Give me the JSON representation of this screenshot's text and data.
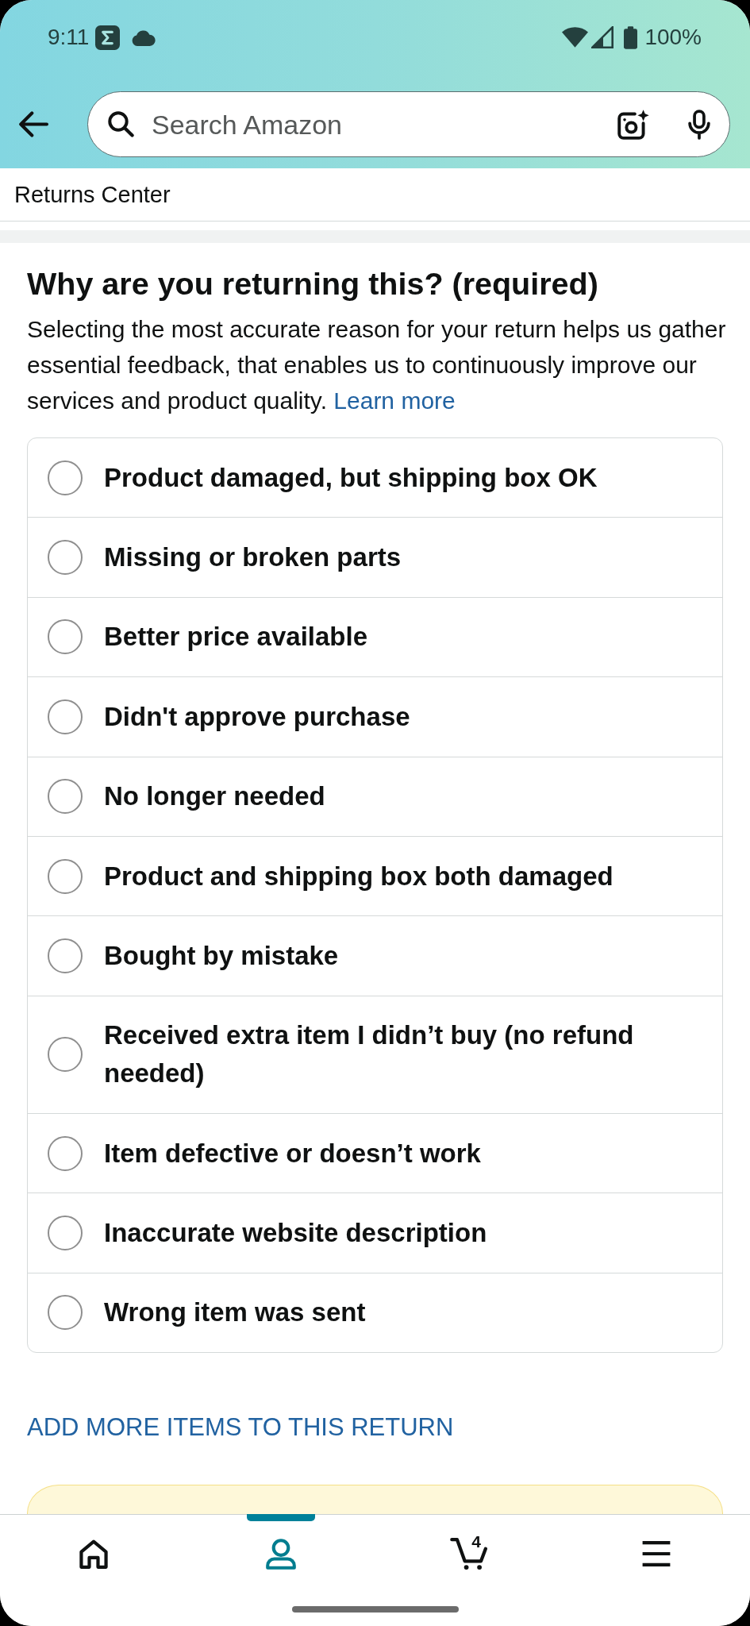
{
  "status_bar": {
    "time": "9:11",
    "battery": "100%"
  },
  "search": {
    "placeholder": "Search Amazon"
  },
  "breadcrumb": "Returns Center",
  "return_reason": {
    "title": "Why are you returning this? (required)",
    "description": "Selecting the most accurate reason for your return helps us gather essential feedback, that enables us to continuously improve our services and product quality.",
    "link": "Learn more",
    "options": [
      {
        "label": "Product damaged, but shipping box OK",
        "selected": false
      },
      {
        "label": "Missing or broken parts",
        "selected": false
      },
      {
        "label": "Better price available",
        "selected": false
      },
      {
        "label": "Didn't approve purchase",
        "selected": false
      },
      {
        "label": "No longer needed",
        "selected": false
      },
      {
        "label": "Product and shipping box both damaged",
        "selected": false
      },
      {
        "label": "Bought by mistake",
        "selected": false
      },
      {
        "label": "Received extra item I didn’t buy (no refund needed)",
        "selected": false
      },
      {
        "label": "Item defective or doesn’t work",
        "selected": false
      },
      {
        "label": "Inaccurate website description",
        "selected": false
      },
      {
        "label": "Wrong item was sent",
        "selected": false
      }
    ]
  },
  "add_more_link": "ADD MORE ITEMS TO THIS RETURN",
  "bottom_nav": [
    {
      "kind": "home",
      "selected": false
    },
    {
      "kind": "account",
      "selected": true
    },
    {
      "kind": "cart",
      "count": "4",
      "selected": false
    },
    {
      "kind": "menu",
      "selected": false
    }
  ]
}
